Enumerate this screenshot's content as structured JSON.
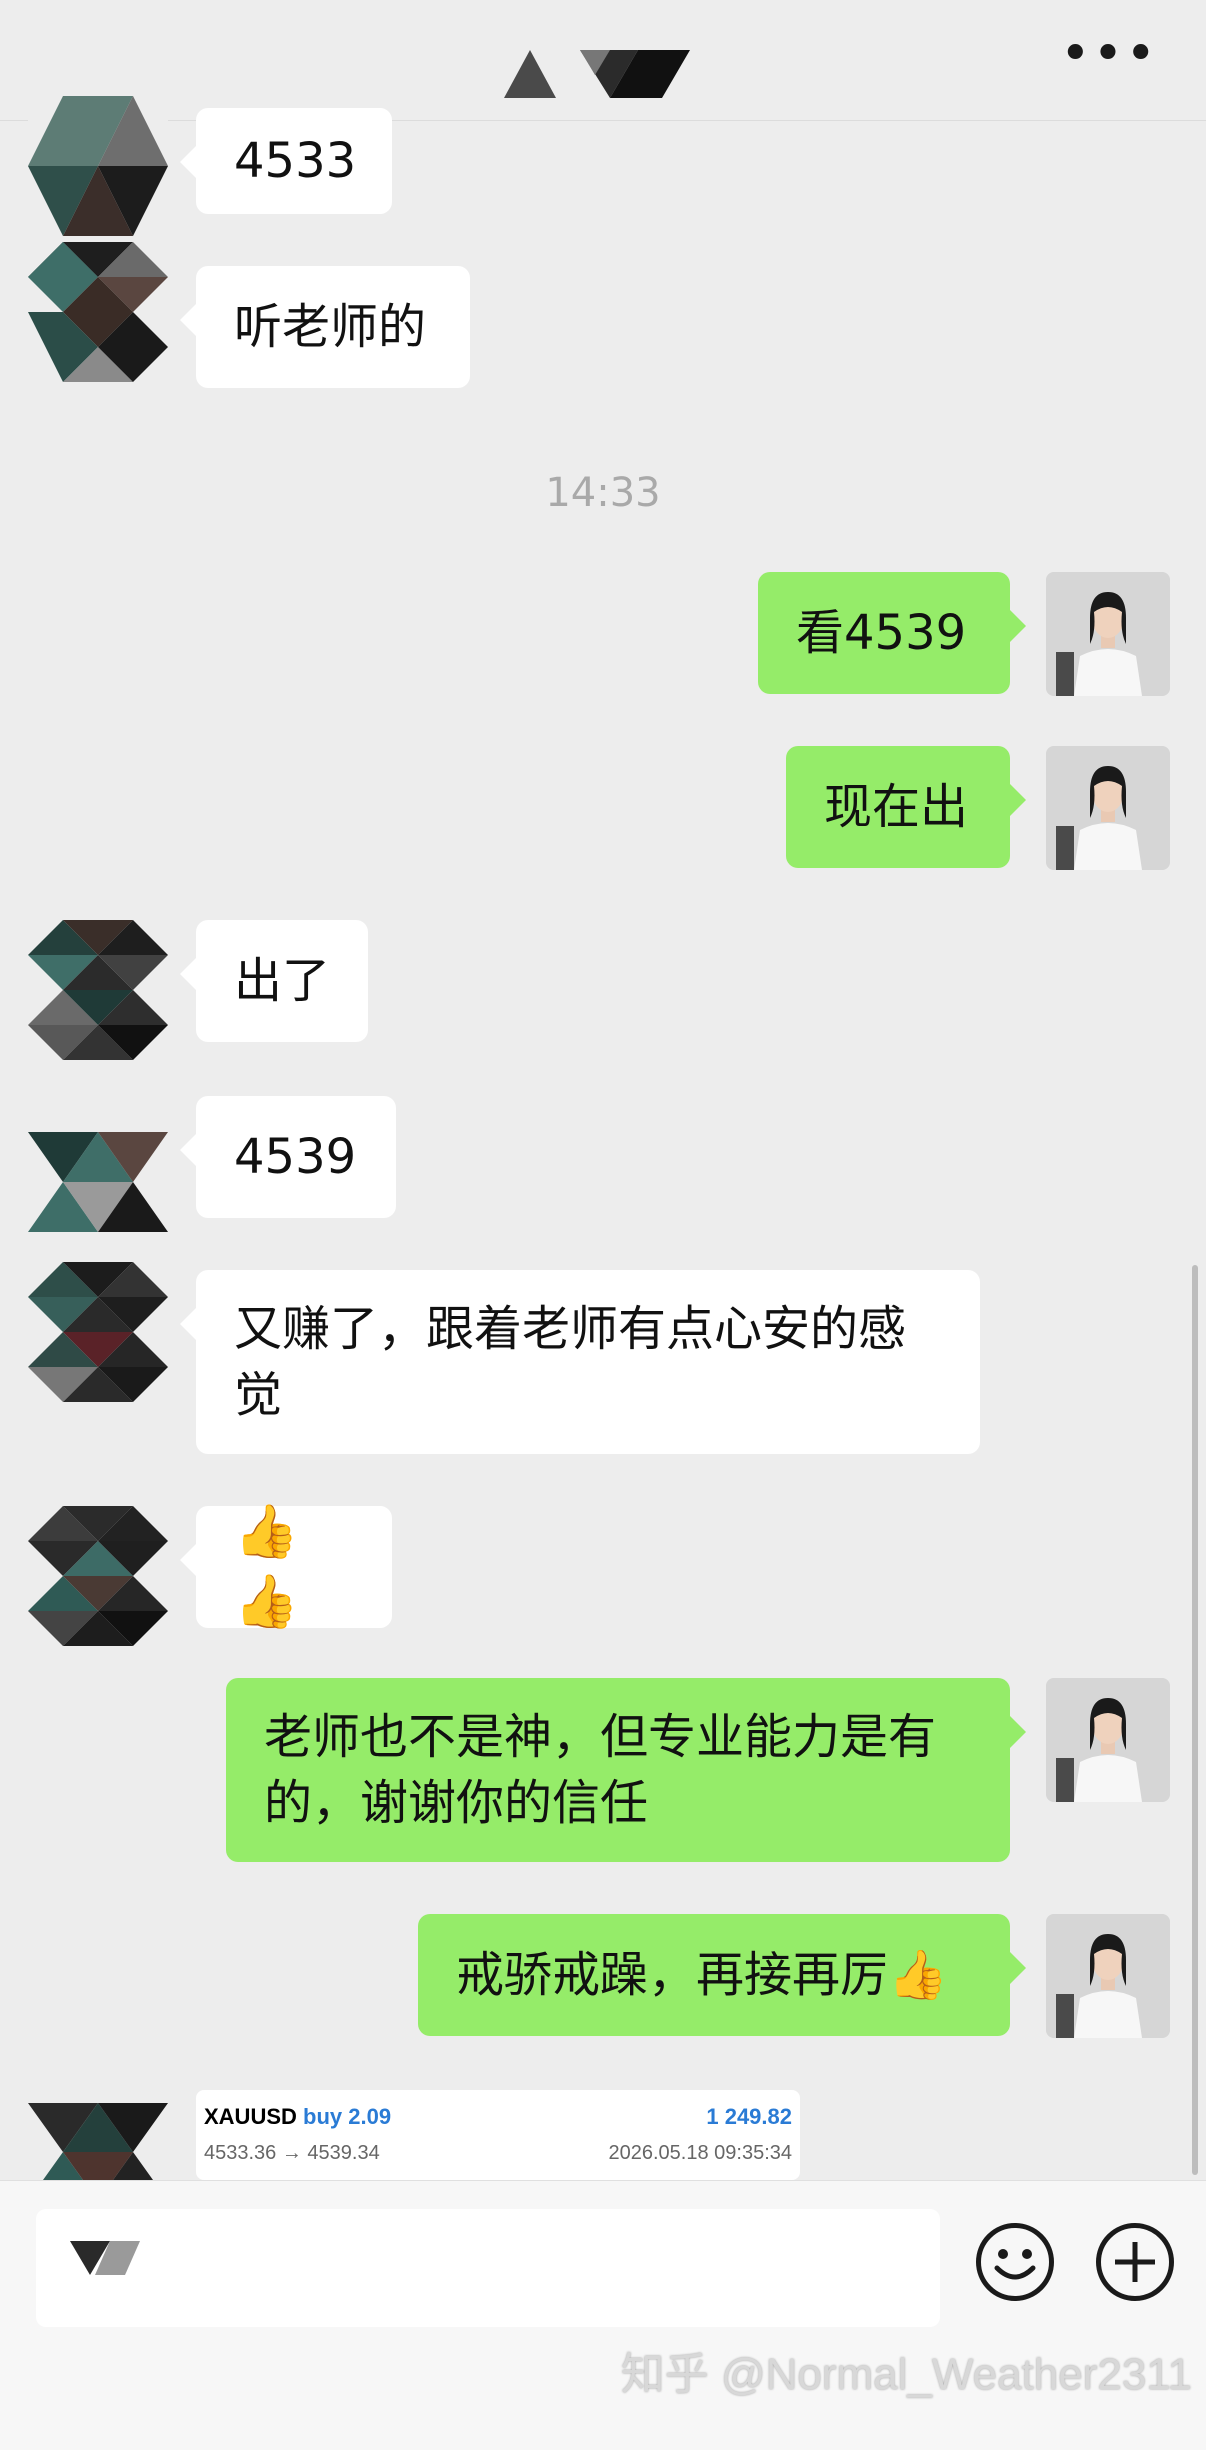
{
  "header": {
    "menu_icon": "more-dots-icon",
    "menu_label": "•••"
  },
  "messages": [
    {
      "side": "in",
      "text": "4533"
    },
    {
      "side": "in",
      "text": "听老师的"
    },
    {
      "side": "out",
      "text": "看4539"
    },
    {
      "side": "out",
      "text": "现在出"
    },
    {
      "side": "in",
      "text": "出了"
    },
    {
      "side": "in",
      "text": "4539"
    },
    {
      "side": "in",
      "text": "又赚了，跟着老师有点心安的感觉"
    },
    {
      "side": "in",
      "text": "👍👍"
    },
    {
      "side": "out",
      "text": "老师也不是神，但专业能力是有的，谢谢你的信任"
    },
    {
      "side": "out",
      "text": "戒骄戒躁，再接再厉👍"
    }
  ],
  "timestamp": "14:33",
  "trade_card": {
    "symbol": "XAUUSD",
    "side": "buy 2.09",
    "profit": "1 249.82",
    "price_range": "4533.36 → 4539.34",
    "datetime": "2026.05.18 09:35:34"
  },
  "watermark": "知乎 @Normal_Weather2311",
  "colors": {
    "out_bubble": "#95ec69",
    "in_bubble": "#ffffff",
    "background": "#ededed",
    "accent_blue": "#2a7bd5"
  }
}
